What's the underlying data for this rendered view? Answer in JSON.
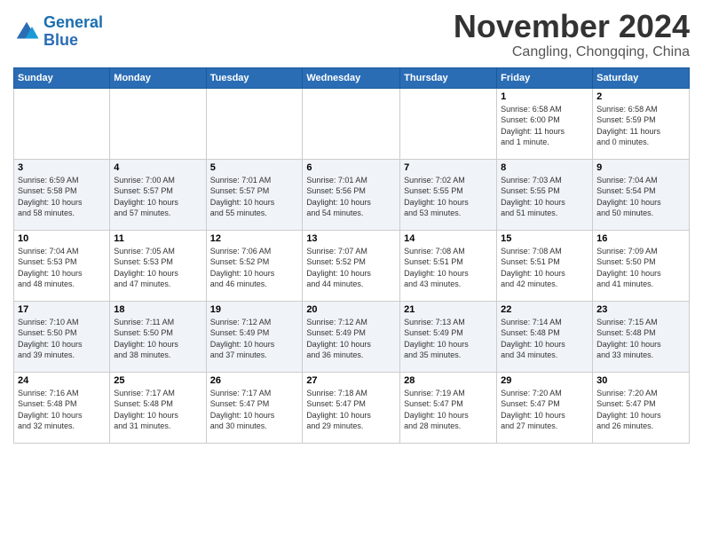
{
  "header": {
    "logo_line1": "General",
    "logo_line2": "Blue",
    "month": "November 2024",
    "location": "Cangling, Chongqing, China"
  },
  "weekdays": [
    "Sunday",
    "Monday",
    "Tuesday",
    "Wednesday",
    "Thursday",
    "Friday",
    "Saturday"
  ],
  "weeks": [
    [
      {
        "day": "",
        "info": ""
      },
      {
        "day": "",
        "info": ""
      },
      {
        "day": "",
        "info": ""
      },
      {
        "day": "",
        "info": ""
      },
      {
        "day": "",
        "info": ""
      },
      {
        "day": "1",
        "info": "Sunrise: 6:58 AM\nSunset: 6:00 PM\nDaylight: 11 hours\nand 1 minute."
      },
      {
        "day": "2",
        "info": "Sunrise: 6:58 AM\nSunset: 5:59 PM\nDaylight: 11 hours\nand 0 minutes."
      }
    ],
    [
      {
        "day": "3",
        "info": "Sunrise: 6:59 AM\nSunset: 5:58 PM\nDaylight: 10 hours\nand 58 minutes."
      },
      {
        "day": "4",
        "info": "Sunrise: 7:00 AM\nSunset: 5:57 PM\nDaylight: 10 hours\nand 57 minutes."
      },
      {
        "day": "5",
        "info": "Sunrise: 7:01 AM\nSunset: 5:57 PM\nDaylight: 10 hours\nand 55 minutes."
      },
      {
        "day": "6",
        "info": "Sunrise: 7:01 AM\nSunset: 5:56 PM\nDaylight: 10 hours\nand 54 minutes."
      },
      {
        "day": "7",
        "info": "Sunrise: 7:02 AM\nSunset: 5:55 PM\nDaylight: 10 hours\nand 53 minutes."
      },
      {
        "day": "8",
        "info": "Sunrise: 7:03 AM\nSunset: 5:55 PM\nDaylight: 10 hours\nand 51 minutes."
      },
      {
        "day": "9",
        "info": "Sunrise: 7:04 AM\nSunset: 5:54 PM\nDaylight: 10 hours\nand 50 minutes."
      }
    ],
    [
      {
        "day": "10",
        "info": "Sunrise: 7:04 AM\nSunset: 5:53 PM\nDaylight: 10 hours\nand 48 minutes."
      },
      {
        "day": "11",
        "info": "Sunrise: 7:05 AM\nSunset: 5:53 PM\nDaylight: 10 hours\nand 47 minutes."
      },
      {
        "day": "12",
        "info": "Sunrise: 7:06 AM\nSunset: 5:52 PM\nDaylight: 10 hours\nand 46 minutes."
      },
      {
        "day": "13",
        "info": "Sunrise: 7:07 AM\nSunset: 5:52 PM\nDaylight: 10 hours\nand 44 minutes."
      },
      {
        "day": "14",
        "info": "Sunrise: 7:08 AM\nSunset: 5:51 PM\nDaylight: 10 hours\nand 43 minutes."
      },
      {
        "day": "15",
        "info": "Sunrise: 7:08 AM\nSunset: 5:51 PM\nDaylight: 10 hours\nand 42 minutes."
      },
      {
        "day": "16",
        "info": "Sunrise: 7:09 AM\nSunset: 5:50 PM\nDaylight: 10 hours\nand 41 minutes."
      }
    ],
    [
      {
        "day": "17",
        "info": "Sunrise: 7:10 AM\nSunset: 5:50 PM\nDaylight: 10 hours\nand 39 minutes."
      },
      {
        "day": "18",
        "info": "Sunrise: 7:11 AM\nSunset: 5:50 PM\nDaylight: 10 hours\nand 38 minutes."
      },
      {
        "day": "19",
        "info": "Sunrise: 7:12 AM\nSunset: 5:49 PM\nDaylight: 10 hours\nand 37 minutes."
      },
      {
        "day": "20",
        "info": "Sunrise: 7:12 AM\nSunset: 5:49 PM\nDaylight: 10 hours\nand 36 minutes."
      },
      {
        "day": "21",
        "info": "Sunrise: 7:13 AM\nSunset: 5:49 PM\nDaylight: 10 hours\nand 35 minutes."
      },
      {
        "day": "22",
        "info": "Sunrise: 7:14 AM\nSunset: 5:48 PM\nDaylight: 10 hours\nand 34 minutes."
      },
      {
        "day": "23",
        "info": "Sunrise: 7:15 AM\nSunset: 5:48 PM\nDaylight: 10 hours\nand 33 minutes."
      }
    ],
    [
      {
        "day": "24",
        "info": "Sunrise: 7:16 AM\nSunset: 5:48 PM\nDaylight: 10 hours\nand 32 minutes."
      },
      {
        "day": "25",
        "info": "Sunrise: 7:17 AM\nSunset: 5:48 PM\nDaylight: 10 hours\nand 31 minutes."
      },
      {
        "day": "26",
        "info": "Sunrise: 7:17 AM\nSunset: 5:47 PM\nDaylight: 10 hours\nand 30 minutes."
      },
      {
        "day": "27",
        "info": "Sunrise: 7:18 AM\nSunset: 5:47 PM\nDaylight: 10 hours\nand 29 minutes."
      },
      {
        "day": "28",
        "info": "Sunrise: 7:19 AM\nSunset: 5:47 PM\nDaylight: 10 hours\nand 28 minutes."
      },
      {
        "day": "29",
        "info": "Sunrise: 7:20 AM\nSunset: 5:47 PM\nDaylight: 10 hours\nand 27 minutes."
      },
      {
        "day": "30",
        "info": "Sunrise: 7:20 AM\nSunset: 5:47 PM\nDaylight: 10 hours\nand 26 minutes."
      }
    ]
  ]
}
